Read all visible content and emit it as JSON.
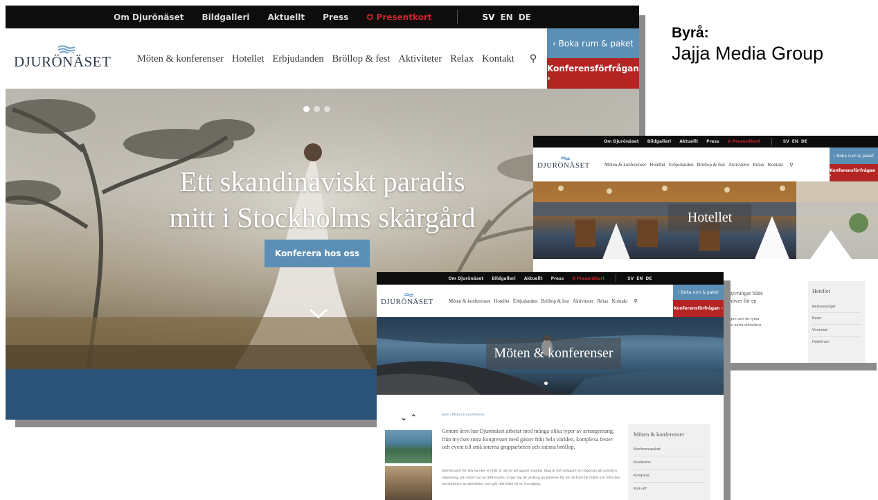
{
  "agency": {
    "label": "Byrå:",
    "name": "Jajja Media Group"
  },
  "brand": {
    "logo_text": "DJURÖNÄSET"
  },
  "topbar": {
    "items": [
      "Om Djurönäset",
      "Bildgalleri",
      "Aktuellt",
      "Press"
    ],
    "gift_label": "Presentkort",
    "gift_icon": "gift-icon",
    "langs": [
      "SV",
      "EN",
      "DE"
    ]
  },
  "nav": {
    "items": [
      "Möten & konferenser",
      "Hotellet",
      "Erbjudanden",
      "Bröllop & fest",
      "Aktiviteter",
      "Relax",
      "Kontakt"
    ],
    "search_icon": "search-icon"
  },
  "cta": {
    "book_label": "‹  Boka rum & paket",
    "conference_label": "Konferensförfrågan  ›"
  },
  "hero": {
    "headline_1": "Ett skandinaviskt paradis",
    "headline_2": "mitt i Stockholms skärgård",
    "button": "Konferera hos oss",
    "chevron_icon": "chevron-down-icon"
  },
  "hotel_page": {
    "banner_title": "Hotellet",
    "intro_line_1": "nngivningar både",
    "intro_line_2": "behöver för en",
    "intro_line_3": "rd.",
    "small_1": "rangen och de tysta",
    "small_2": "e ger extra stimulans",
    "side_title": "Hotellet",
    "side_items": [
      "Restauranger",
      "Barer",
      "Vinrinket",
      "Hotellrum"
    ]
  },
  "meeting_page": {
    "banner_title": "Möten & konferenser",
    "breadcrumb": "Hem / Möten & konferenser",
    "arrows": "⌄ ⌃",
    "lead": "Genom åren har Djurönäset arbetat med många olika typer av arrangemang; från mycket stora kongresser med gäster från hela världen, komplexa fester och event till små interna grupparbeten och intima bröllop.",
    "body": "Gemensamt för alla kunder vi mött är att de vill uppnå resultat. Idag är det viktigare än någonsin att prestera någonting, att mötet har en affärsnytta. Vi ger dig de verktyg du behöver för att nå fram till målet och hitta den kombination av aktiviteter som gör ditt möte till en framgång.",
    "side_title": "Möten & konferenser",
    "side_items": [
      "Konferenspaket",
      "Konferens",
      "Kongress",
      "Kick-off"
    ]
  },
  "colors": {
    "brand_blue": "#5b8fb5",
    "brand_red": "#b32423",
    "footer_blue": "#2b5278",
    "topbar": "#0d0d0d"
  }
}
